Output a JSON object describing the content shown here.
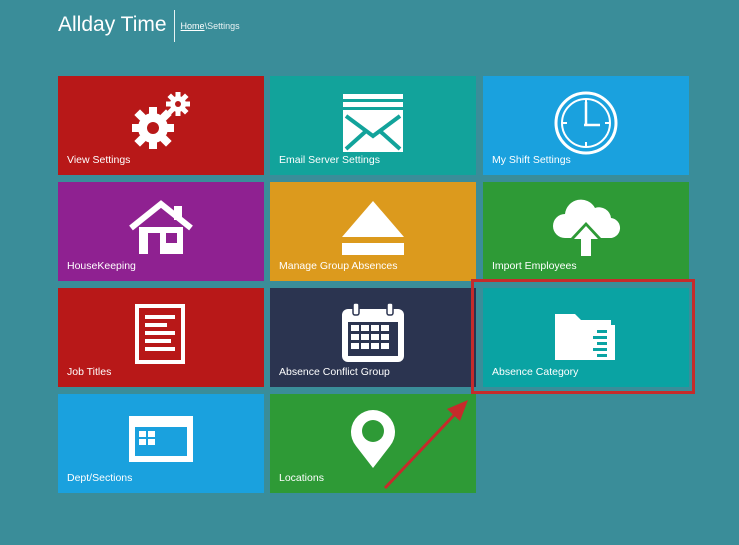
{
  "header": {
    "app_title": "Allday Time",
    "breadcrumb_home": "Home",
    "breadcrumb_separator": "\\",
    "breadcrumb_current": "Settings"
  },
  "tiles": [
    {
      "label": "View Settings",
      "color": "#b81818",
      "icon": "gears-icon"
    },
    {
      "label": "Email Server Settings",
      "color": "#12a39b",
      "icon": "envelope-icon"
    },
    {
      "label": "My Shift Settings",
      "color": "#1aa1de",
      "icon": "clock-icon"
    },
    {
      "label": "HouseKeeping",
      "color": "#8f2191",
      "icon": "house-icon"
    },
    {
      "label": "Manage Group Absences",
      "color": "#dc9a1d",
      "icon": "eject-icon"
    },
    {
      "label": "Import Employees",
      "color": "#2e9a36",
      "icon": "cloud-upload-icon"
    },
    {
      "label": "Job Titles",
      "color": "#b81818",
      "icon": "document-icon"
    },
    {
      "label": "Absence Conflict Group",
      "color": "#2b3450",
      "icon": "calendar-icon"
    },
    {
      "label": "Absence Category",
      "color": "#0aa3a3",
      "icon": "folder-icon"
    },
    {
      "label": "Dept/Sections",
      "color": "#1aa1de",
      "icon": "window-icon"
    },
    {
      "label": "Locations",
      "color": "#2e9a36",
      "icon": "map-pin-icon"
    }
  ],
  "annotation": {
    "color": "#c62b2b"
  }
}
